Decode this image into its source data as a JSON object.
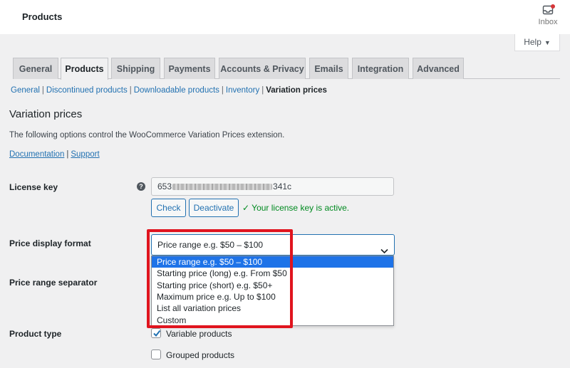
{
  "header": {
    "title": "Products",
    "inbox_label": "Inbox",
    "help_label": "Help"
  },
  "tabs": [
    {
      "label": "General"
    },
    {
      "label": "Products"
    },
    {
      "label": "Shipping"
    },
    {
      "label": "Payments"
    },
    {
      "label": "Accounts & Privacy"
    },
    {
      "label": "Emails"
    },
    {
      "label": "Integration"
    },
    {
      "label": "Advanced"
    }
  ],
  "subnav": [
    {
      "label": "General"
    },
    {
      "label": "Discontinued products"
    },
    {
      "label": "Downloadable products"
    },
    {
      "label": "Inventory"
    },
    {
      "label": "Variation prices"
    }
  ],
  "section": {
    "title": "Variation prices",
    "description": "The following options control the WooCommerce Variation Prices extension.",
    "documentation_link": "Documentation",
    "support_link": "Support"
  },
  "license": {
    "label": "License key",
    "help_icon": "question-icon",
    "value_prefix": "653",
    "value_suffix": "341c",
    "check_button": "Check",
    "deactivate_button": "Deactivate",
    "status": "✓ Your license key is active."
  },
  "price_display": {
    "label": "Price display format",
    "selected": "Price range e.g. $50 – $100",
    "options": [
      "Price range e.g. $50 – $100",
      "Starting price (long) e.g. From $50",
      "Starting price (short) e.g. $50+",
      "Maximum price e.g. Up to $100",
      "List all variation prices",
      "Custom"
    ]
  },
  "price_range_separator": {
    "label": "Price range separator"
  },
  "product_type": {
    "label": "Product type",
    "options": [
      {
        "label": "Variable products",
        "checked": true
      },
      {
        "label": "Grouped products",
        "checked": false
      }
    ]
  },
  "colors": {
    "accent": "#2271b1",
    "highlight": "#e0141e",
    "selected_option": "#1e73e8",
    "success": "#008a20"
  }
}
